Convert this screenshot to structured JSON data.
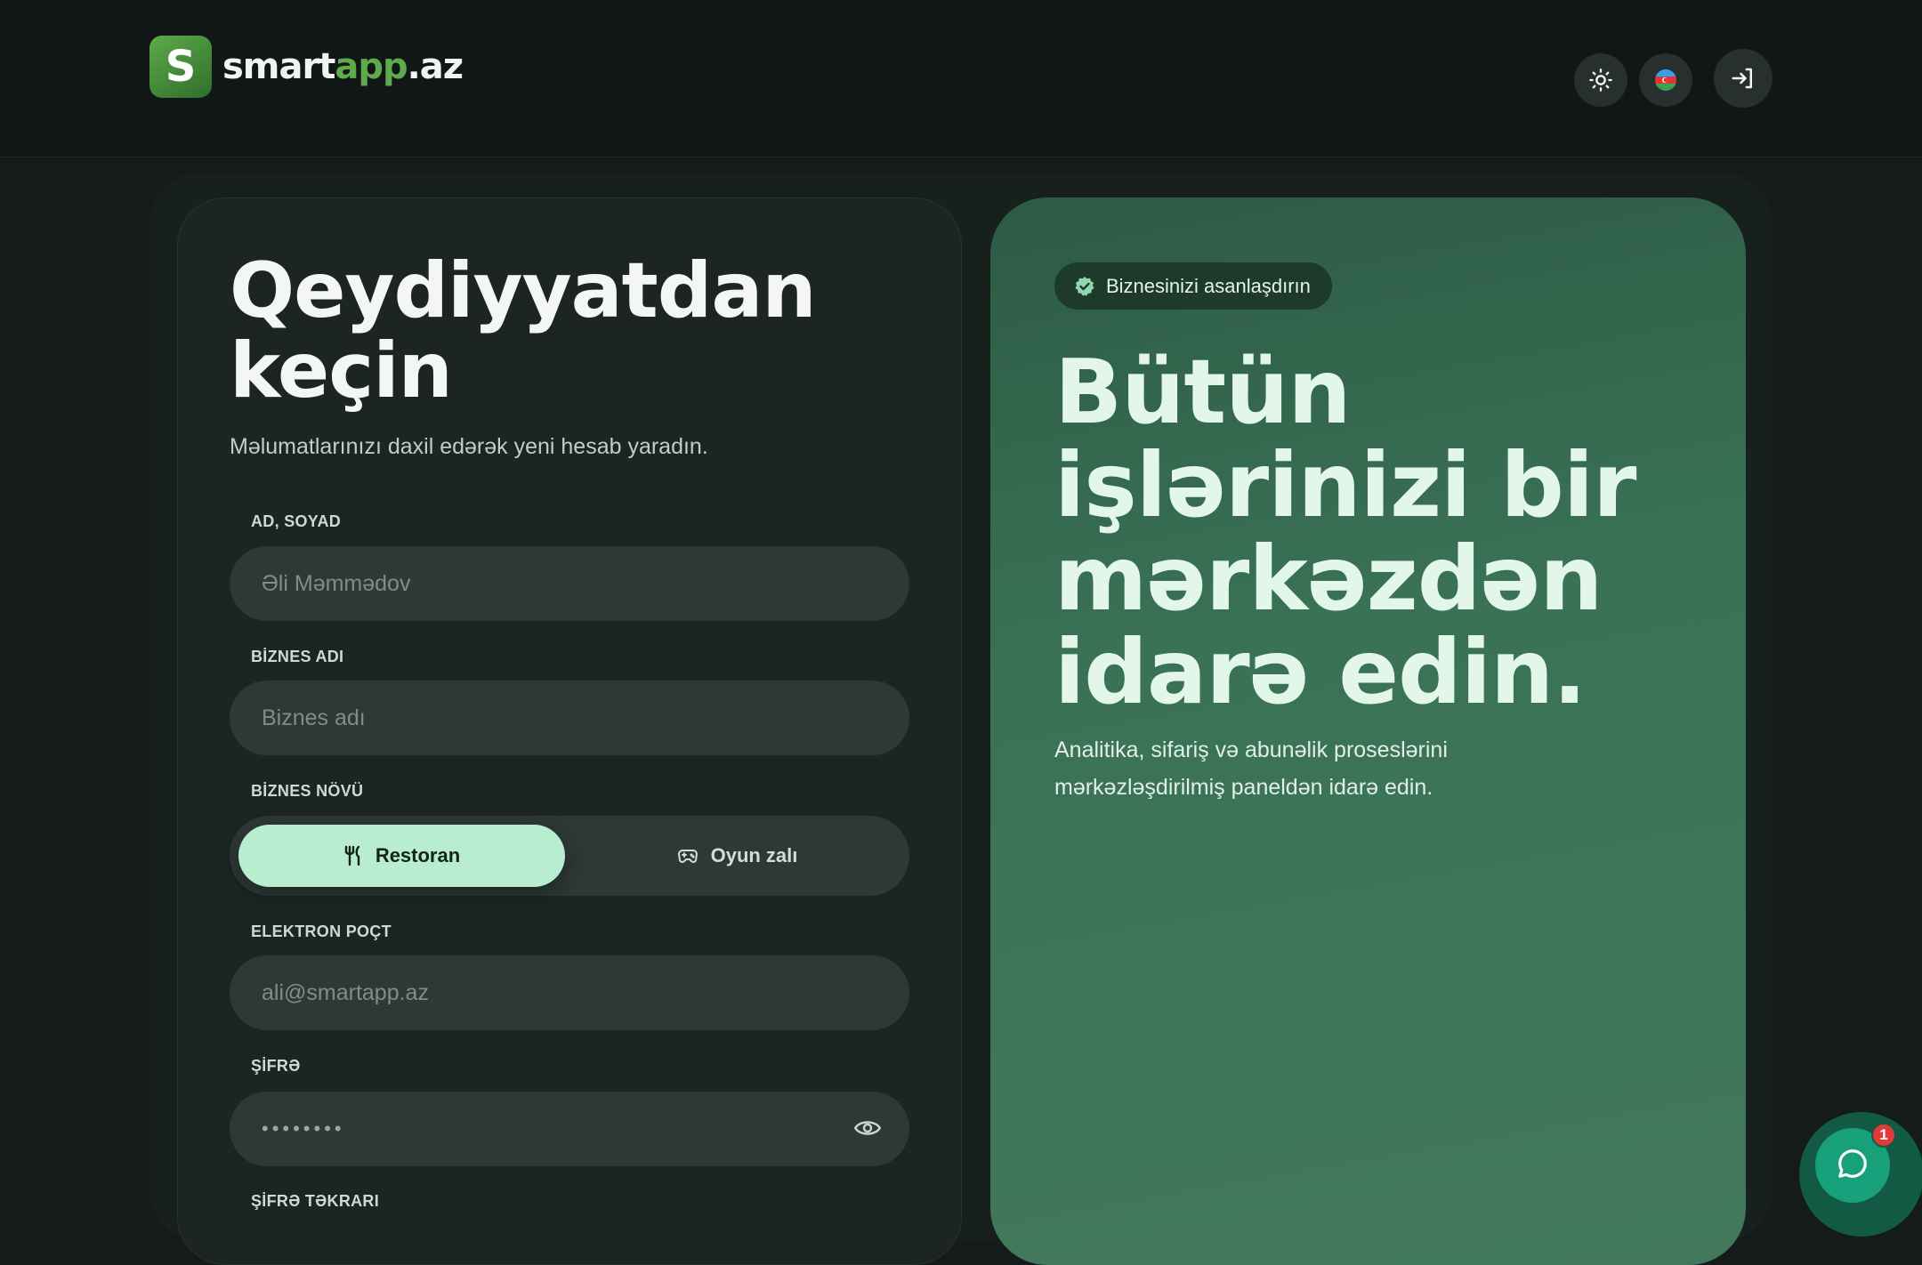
{
  "header": {
    "logo": {
      "part1": "smart",
      "part2": "app",
      "part3": ".az",
      "mark": "S"
    },
    "theme_icon": "sun-icon",
    "language_icon": "azerbaijan-flag-icon",
    "login_icon": "login-icon"
  },
  "form": {
    "title": "Qeydiyyatdan keçin",
    "subtitle": "Məlumatlarınızı daxil edərək yeni hesab yaradın.",
    "full_name": {
      "label": "AD, SOYAD",
      "placeholder": "Əli Məmmədov"
    },
    "business_name": {
      "label": "BİZNES ADI",
      "placeholder": "Biznes adı"
    },
    "business_type": {
      "label": "BİZNES NÖVÜ",
      "options": [
        {
          "label": "Restoran",
          "icon": "fork-knife-icon",
          "selected": true
        },
        {
          "label": "Oyun zalı",
          "icon": "gamepad-icon",
          "selected": false
        }
      ]
    },
    "email": {
      "label": "ELEKTRON POÇT",
      "placeholder": "ali@smartapp.az"
    },
    "password": {
      "label": "ŞİFRƏ",
      "value": "••••••••"
    },
    "password_confirm": {
      "label": "ŞİFRƏ TƏKRARI"
    }
  },
  "hero": {
    "badge": "Biznesinizi asanlaşdırın",
    "title": "Bütün işlərinizi bir mərkəzdən idarə edin.",
    "description": "Analitika, sifariş və abunəlik proseslərini mərkəzləşdirilmiş paneldən idarə edin."
  },
  "chat": {
    "badge_count": "1"
  },
  "colors": {
    "accent": "#b8edcf",
    "brand_green": "#5faa4c",
    "hero_bg": "#3a7256",
    "chat_button": "#17a07a",
    "notification": "#e23a3a"
  }
}
